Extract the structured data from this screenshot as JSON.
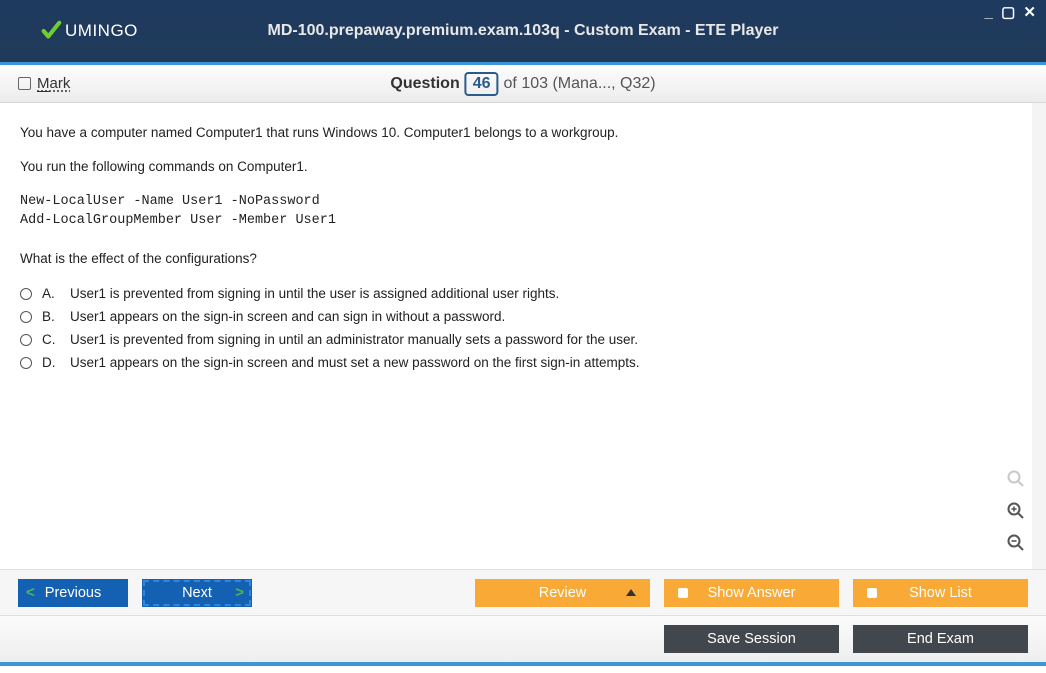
{
  "window": {
    "brand": "UMINGO",
    "title": "MD-100.prepaway.premium.exam.103q - Custom Exam - ETE Player"
  },
  "header": {
    "mark_label": "Mark",
    "question_word": "Question",
    "question_num": "46",
    "of_text": "of 103 (Mana..., Q32)"
  },
  "question": {
    "para1": "You have a computer named Computer1 that runs Windows 10. Computer1 belongs to a workgroup.",
    "para2": "You run the following commands on Computer1.",
    "code": "New-LocalUser -Name User1 -NoPassword\nAdd-LocalGroupMember User -Member User1",
    "para3": "What is the effect of the configurations?",
    "answers": [
      {
        "letter": "A.",
        "text": "User1 is prevented from signing in until the user is assigned additional user rights."
      },
      {
        "letter": "B.",
        "text": "User1 appears on the sign-in screen and can sign in without a password."
      },
      {
        "letter": "C.",
        "text": "User1 is prevented from signing in until an administrator manually sets a password for the user."
      },
      {
        "letter": "D.",
        "text": "User1 appears on the sign-in screen and must set a new password on the first sign-in attempts."
      }
    ]
  },
  "nav": {
    "previous": "Previous",
    "next": "Next",
    "review": "Review",
    "show_answer": "Show Answer",
    "show_list": "Show List"
  },
  "bottom": {
    "save_session": "Save Session",
    "end_exam": "End Exam"
  }
}
